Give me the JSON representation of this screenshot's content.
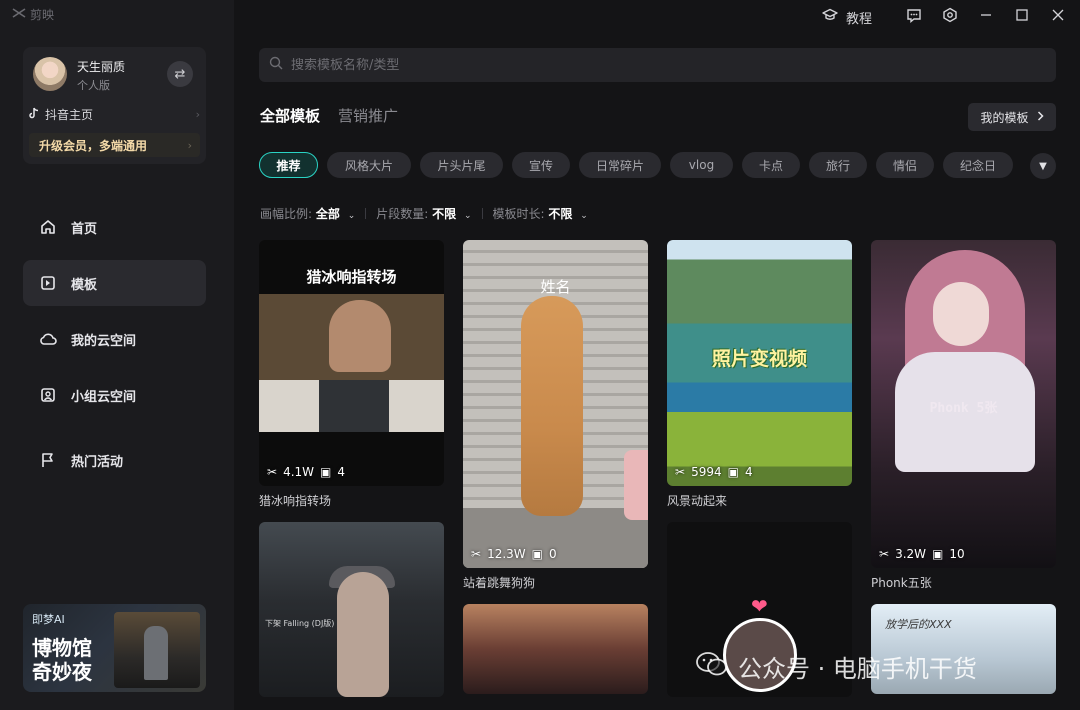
{
  "app": {
    "brand": "剪映"
  },
  "titlebar": {
    "tutorial": "教程"
  },
  "profile": {
    "name": "天生丽质",
    "subtitle": "个人版",
    "douyin": "抖音主页",
    "vip": "升级会员，多端通用"
  },
  "nav": [
    {
      "label": "首页",
      "icon": "home-icon",
      "active": false
    },
    {
      "label": "模板",
      "icon": "template-icon",
      "active": true
    },
    {
      "label": "我的云空间",
      "icon": "cloud-icon",
      "active": false
    },
    {
      "label": "小组云空间",
      "icon": "group-cloud-icon",
      "active": false
    },
    {
      "label": "热门活动",
      "icon": "flag-icon",
      "active": false
    }
  ],
  "promo": {
    "logo": "即梦AI",
    "title_line1": "博物馆",
    "title_line2": "奇妙夜"
  },
  "search": {
    "placeholder": "搜索模板名称/类型"
  },
  "tabs": [
    {
      "label": "全部模板",
      "active": true
    },
    {
      "label": "营销推广",
      "active": false
    }
  ],
  "my_templates": "我的模板",
  "chips": [
    "推荐",
    "风格大片",
    "片头片尾",
    "宣传",
    "日常碎片",
    "vlog",
    "卡点",
    "旅行",
    "情侣",
    "纪念日"
  ],
  "filters": [
    {
      "label": "画幅比例:",
      "value": "全部"
    },
    {
      "label": "片段数量:",
      "value": "不限"
    },
    {
      "label": "模板时长:",
      "value": "不限"
    }
  ],
  "cards": [
    {
      "title": "猎冰响指转场",
      "overlay": "猎冰响指转场",
      "uses": "4.1W",
      "clips": "4"
    },
    {
      "title": "站着跳舞狗狗",
      "overlay": "姓名",
      "uses": "12.3W",
      "clips": "0"
    },
    {
      "title": "风景动起来",
      "overlay": "照片变视频",
      "uses": "5994",
      "clips": "4"
    },
    {
      "title": "Phonk五张",
      "overlay": "Phonk 5张",
      "uses": "3.2W",
      "clips": "10"
    }
  ],
  "card5": {
    "small_text": "下架 Falling (DJ版)"
  },
  "card8": {
    "overlay": "放学后的XXX"
  },
  "watermark": {
    "text": "公众号 · 电脑手机干货"
  }
}
